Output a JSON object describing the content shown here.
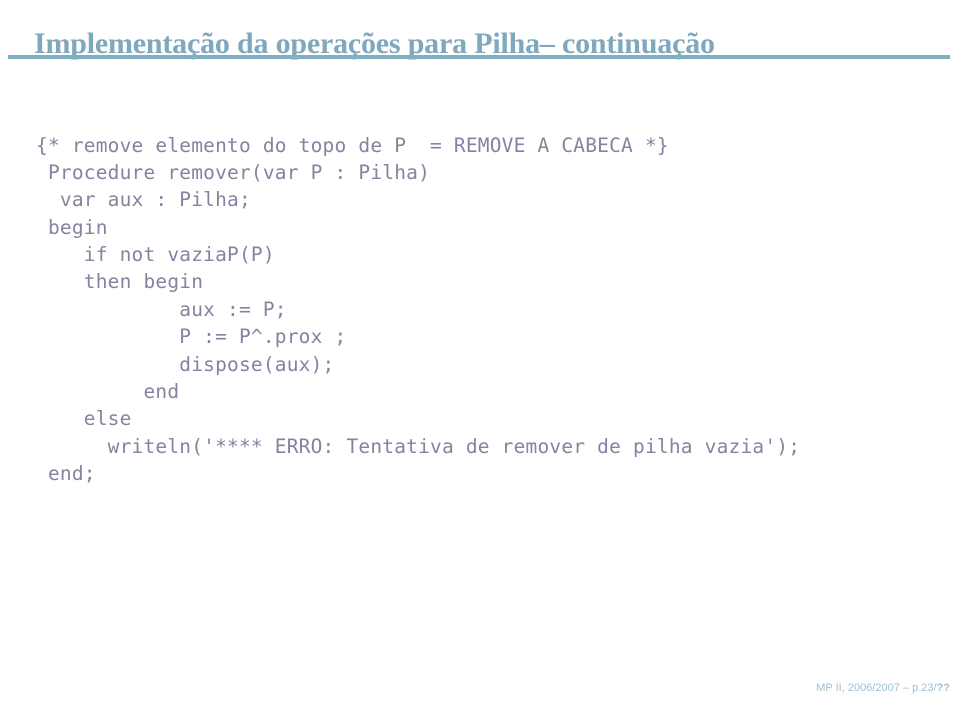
{
  "slide": {
    "title": "Implementação da operações para Pilha– continuação",
    "accent_color": "#7fa8be",
    "rule_color": "#7fb0c2",
    "code_color": "#83849f",
    "background_color": "#ffffff"
  },
  "code": {
    "language": "pascal",
    "lines": [
      "{* remove elemento do topo de P  = REMOVE A CABECA *}",
      " Procedure remover(var P : Pilha)",
      "  var aux : Pilha;",
      " begin",
      "    if not vaziaP(P)",
      "    then begin",
      "            aux := P;",
      "            P := P^.prox ;",
      "            dispose(aux);",
      "         end",
      "    else",
      "      writeln('**** ERRO: Tentativa de remover de pilha vazia');",
      " end;"
    ]
  },
  "footer": {
    "course": "MP II, 2006/2007",
    "separator": " – ",
    "page": "p.23/",
    "total": "??",
    "full_text": "MP II, 2006/2007 – p.23/??"
  }
}
